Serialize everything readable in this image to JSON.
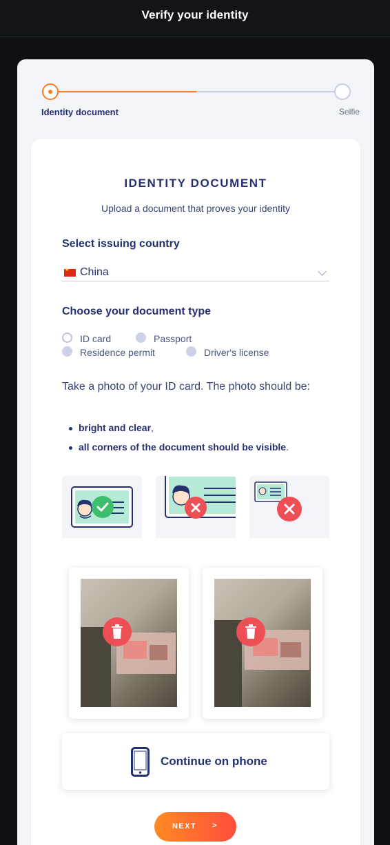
{
  "header": {
    "title": "Verify your identity"
  },
  "stepper": {
    "steps": [
      {
        "label": "Identity document"
      },
      {
        "label": "Selfie"
      }
    ],
    "progress": 0.5
  },
  "document": {
    "title": "IDENTITY DOCUMENT",
    "subtitle": "Upload a document that proves your identity",
    "country_label": "Select issuing country",
    "country_value": "China",
    "type_label": "Choose your document type",
    "types": [
      {
        "label": "ID card",
        "selected": true
      },
      {
        "label": "Passport",
        "selected": false
      },
      {
        "label": "Residence permit",
        "selected": false
      },
      {
        "label": "Driver's license",
        "selected": false
      }
    ],
    "instructions": "Take a photo of your ID card. The photo should be:",
    "requirements": [
      {
        "text": "bright and clear",
        "suffix": ","
      },
      {
        "text": "all corners of the document should be visible",
        "suffix": "."
      }
    ]
  },
  "continue_on_phone": {
    "label": "Continue on phone"
  },
  "next_button": {
    "label": "NEXT",
    "arrow": ">"
  },
  "colors": {
    "accent": "#ff7a1f",
    "navy": "#25306e",
    "error": "#ee4f54",
    "success": "#3bbf6c"
  },
  "icons": [
    "check-icon",
    "close-icon",
    "trash-icon",
    "phone-icon",
    "chevron-down-icon"
  ]
}
